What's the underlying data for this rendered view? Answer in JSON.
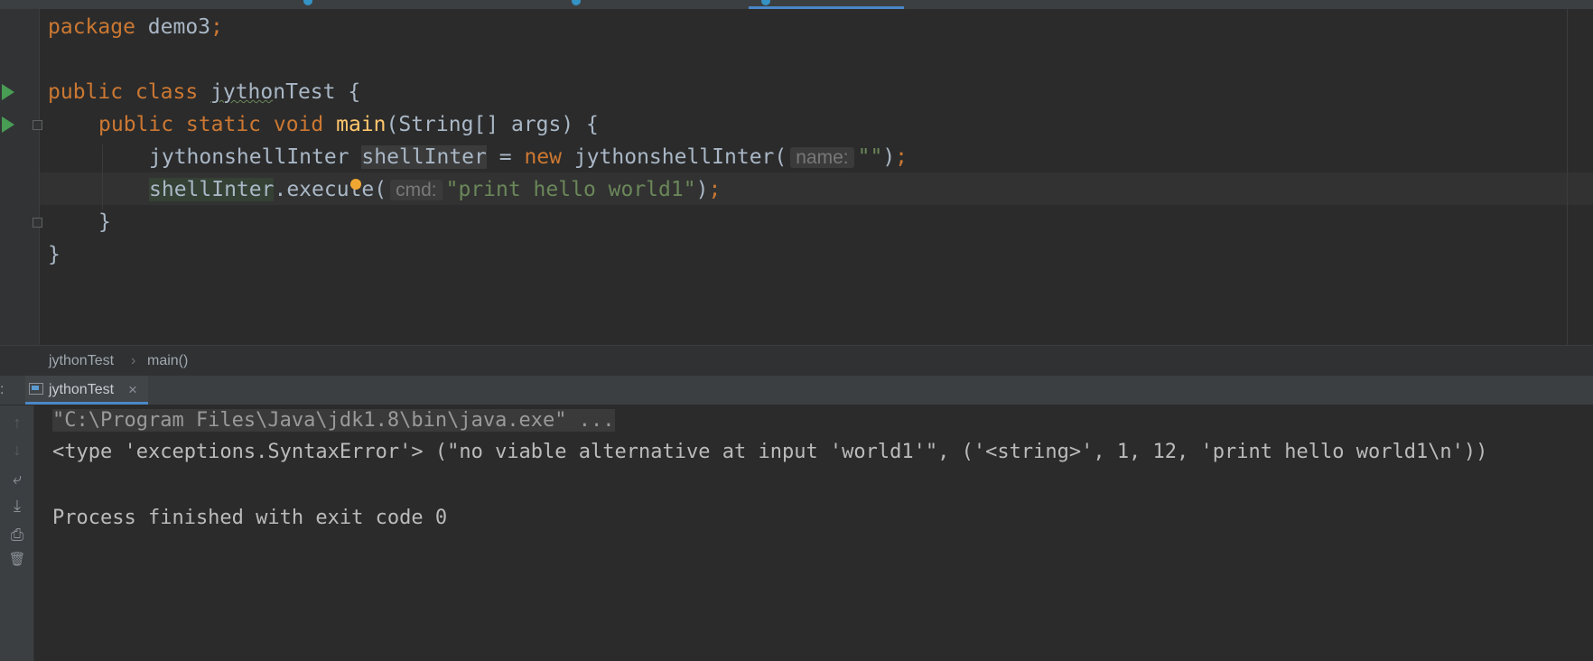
{
  "editor": {
    "lines": {
      "l1_kw": "package",
      "l1_rest": " demo3",
      "l1_semi": ";",
      "l3_kw": "public class ",
      "l3_cls_a": "jytho",
      "l3_cls_b": "nTest",
      "l3_rest": " {",
      "l4_kw": "public static void ",
      "l4_fn": "main",
      "l4_rest": "(String[] args) {",
      "l5_type": "jythonshellInter ",
      "l5_var": "shellInter",
      "l5_eq": " = ",
      "l5_new": "new ",
      "l5_ctor": "jythonshellInter(",
      "l5_hint": "name:",
      "l5_str": "\"\"",
      "l5_end": ")",
      "l5_semi": ";",
      "l6_var": "shellInter",
      "l6_call": ".execute(",
      "l6_hint": "cmd:",
      "l6_str": "\"print hello world1\"",
      "l6_end": ")",
      "l6_semi": ";",
      "l7": "}",
      "l8": "}"
    }
  },
  "breadcrumb": {
    "class": "jythonTest",
    "sep": "›",
    "method": "main()"
  },
  "run_panel": {
    "prefix": ":",
    "tab_label": "jythonTest",
    "tab_close": "×",
    "tools": {
      "up": "↑",
      "down": "↓",
      "wrap": "⤶",
      "scroll_end": "⤓",
      "print": "⎙",
      "trash": "🗑"
    }
  },
  "console": {
    "command": "\"C:\\Program Files\\Java\\jdk1.8\\bin\\java.exe\" ...",
    "error": "<type 'exceptions.SyntaxError'> (\"no viable alternative at input 'world1'\", ('<string>', 1, 12, 'print hello world1\\n'))",
    "exit": "Process finished with exit code 0"
  },
  "colors": {
    "keyword": "#cc7832",
    "function": "#ffc66d",
    "string": "#6a8759",
    "text": "#a9b7c6",
    "run_icon": "#499c54",
    "warning_dot": "#f0a732",
    "tab_underline": "#4a88c7"
  }
}
